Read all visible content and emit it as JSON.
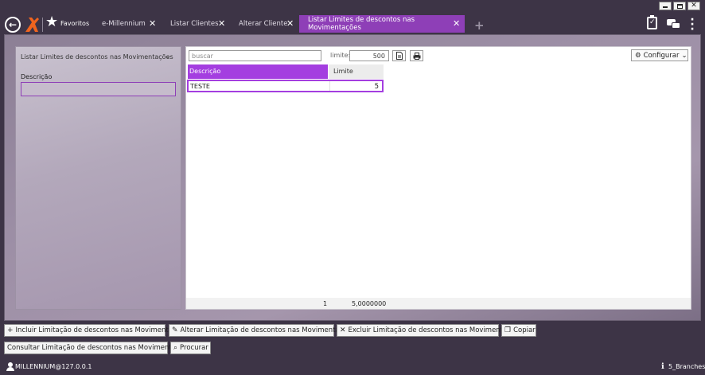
{
  "window": {
    "controls": [
      "minimize-icon",
      "maximize-icon",
      "close-icon"
    ]
  },
  "topbar": {
    "favorites_label": "Favoritos",
    "tabs": [
      {
        "label": "e-Millennium"
      },
      {
        "label": "Listar Clientes"
      },
      {
        "label": "Alterar Cliente"
      },
      {
        "label": "Listar Limites de descontos nas Movimentações",
        "active": true
      }
    ],
    "icons": [
      "back-arrow-icon",
      "logo-icon",
      "star-icon",
      "add-tab-icon",
      "clipboard-check-icon",
      "chat-icon",
      "kebab-menu-icon"
    ]
  },
  "filter_panel": {
    "title": "Listar Limites de descontos nas Movimentações",
    "description_label": "Descrição",
    "description_value": ""
  },
  "grid": {
    "search_placeholder": "buscar",
    "limit_label": "limite:",
    "limit_value": "500",
    "configure_label": "Configurar",
    "columns": [
      "Descrição",
      "Limite"
    ],
    "rows": [
      {
        "descricao": "TESTE",
        "limite": "5"
      }
    ],
    "footer": {
      "count": "1",
      "total": "5,0000000"
    }
  },
  "actions": {
    "incluir": "Incluir Limitação de descontos nas Movimentações",
    "alterar": "Alterar Limitação de descontos nas Movimentações",
    "excluir": "Excluir Limitação de descontos nas Movimentações",
    "copiar": "Copiar",
    "consultar": "Consultar Limitação de descontos nas Movimentações",
    "procurar": "Procurar"
  },
  "statusbar": {
    "user": "MILLENNIUM@127.0.0.1",
    "branch": "5_Branches"
  },
  "colors": {
    "accent": "#a43ee0",
    "active_tab": "#8e3fb7",
    "frame": "#3d3446"
  }
}
